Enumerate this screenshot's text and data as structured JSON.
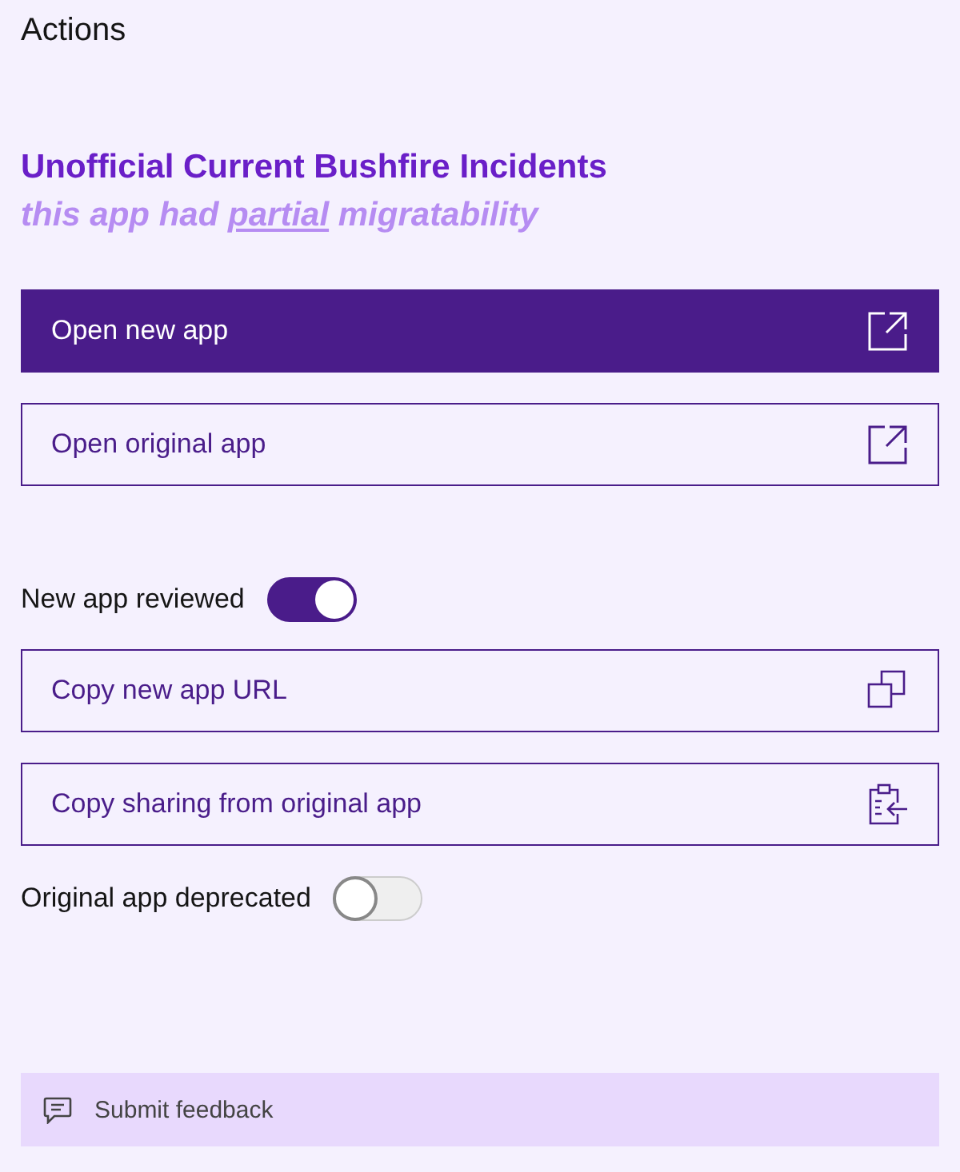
{
  "header": {
    "title": "Actions"
  },
  "app": {
    "title": "Unofficial Current Bushfire Incidents",
    "subtitle": [
      {
        "text": "this app had ",
        "underlined": false
      },
      {
        "text": "partial",
        "underlined": true
      },
      {
        "text": " migratability",
        "underlined": false
      }
    ]
  },
  "actions": [
    {
      "kind": "launch",
      "label": "Open new app",
      "primary": true
    },
    {
      "kind": "launch",
      "label": "Open original app",
      "primary": false
    },
    {
      "kind": "toggle",
      "label": "New app reviewed",
      "on": true
    },
    {
      "kind": "copy",
      "label": "Copy new app URL",
      "primary": false
    },
    {
      "kind": "clipboard",
      "label": "Copy sharing from original app",
      "primary": false
    },
    {
      "kind": "toggle",
      "label": "Original app deprecated",
      "on": false
    }
  ],
  "feedback": {
    "label": "Submit feedback"
  }
}
